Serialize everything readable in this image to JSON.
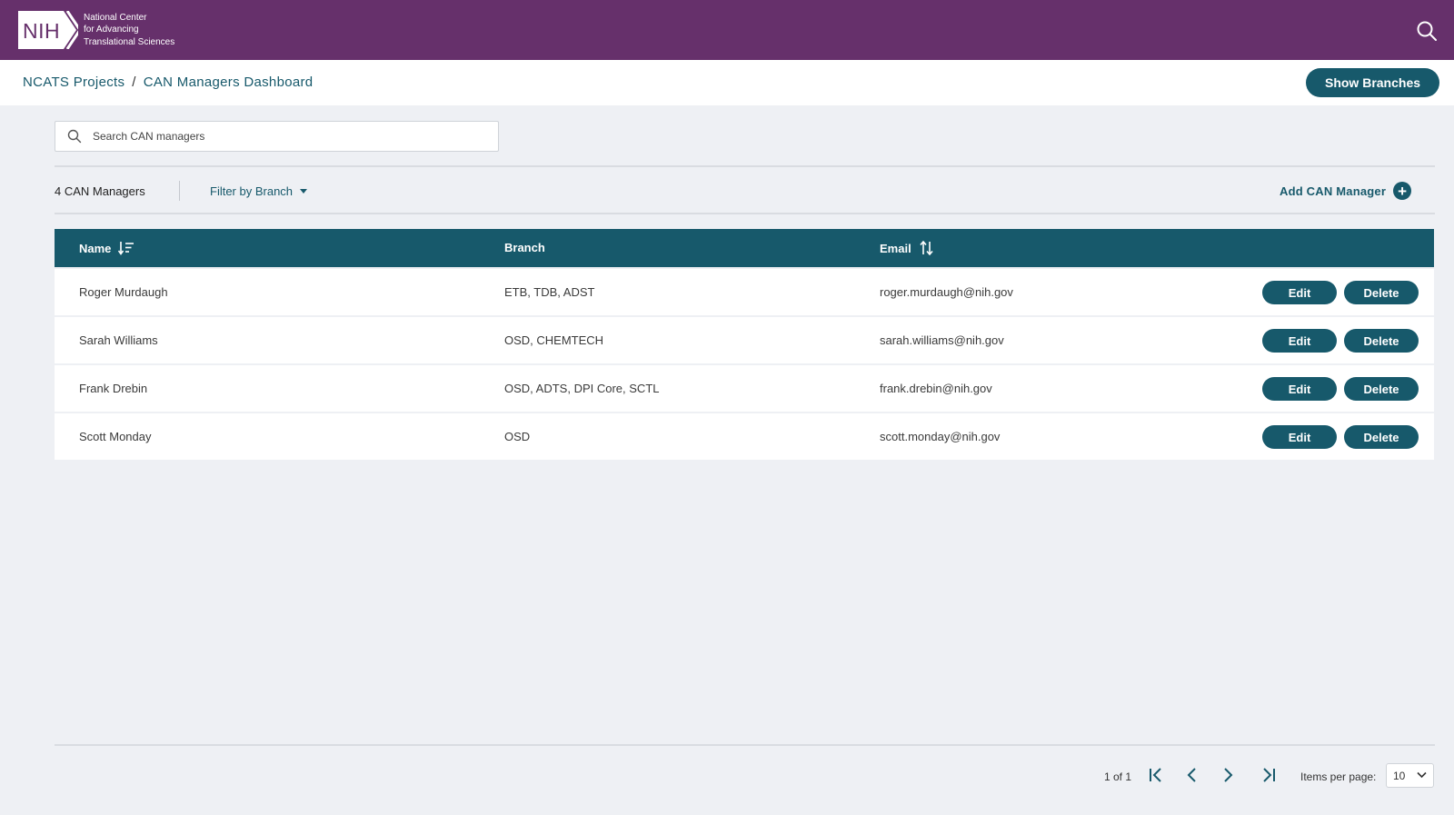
{
  "brand": {
    "logo_text": "NIH",
    "org_lines": [
      "National Center",
      "for Advancing",
      "Translational Sciences"
    ],
    "purple": "#66306b",
    "teal": "#17596b"
  },
  "header": {
    "breadcrumb": [
      "NCATS Projects",
      "CAN Managers Dashboard"
    ],
    "separator": "/",
    "show_branches_label": "Show Branches"
  },
  "search": {
    "placeholder": "Search CAN managers",
    "value": ""
  },
  "toolbar": {
    "count_label": "4 CAN Managers",
    "filter_label": "Filter by Branch",
    "add_label": "Add CAN Manager"
  },
  "table": {
    "columns": [
      "Name",
      "Branch",
      "Email"
    ],
    "rows": [
      {
        "name": "Roger Murdaugh",
        "branch": "ETB, TDB, ADST",
        "email": "roger.murdaugh@nih.gov"
      },
      {
        "name": "Sarah Williams",
        "branch": "OSD, CHEMTECH",
        "email": "sarah.williams@nih.gov"
      },
      {
        "name": "Frank Drebin",
        "branch": "OSD, ADTS, DPI Core, SCTL",
        "email": "frank.drebin@nih.gov"
      },
      {
        "name": "Scott Monday",
        "branch": "OSD",
        "email": "scott.monday@nih.gov"
      }
    ],
    "edit_label": "Edit",
    "delete_label": "Delete"
  },
  "pagination": {
    "page_info": "1 of 1",
    "items_per_page_label": "Items per page:",
    "items_per_page_value": "10"
  }
}
